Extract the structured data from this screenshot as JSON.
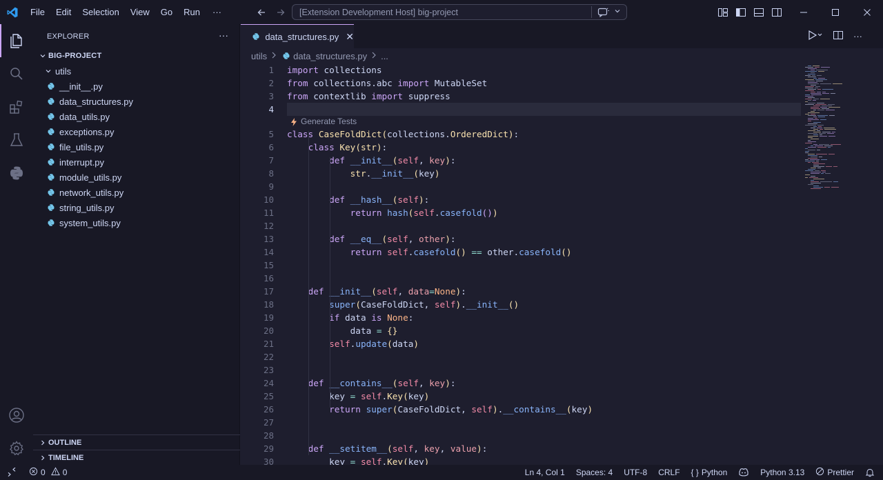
{
  "menu": [
    "File",
    "Edit",
    "Selection",
    "View",
    "Go",
    "Run"
  ],
  "menu_more": "···",
  "command_center": "[Extension Development Host] big-project",
  "explorer": {
    "title": "EXPLORER",
    "more": "···",
    "project": "BIG-PROJECT",
    "folder": "utils",
    "files": [
      "__init__.py",
      "data_structures.py",
      "data_utils.py",
      "exceptions.py",
      "file_utils.py",
      "interrupt.py",
      "module_utils.py",
      "network_utils.py",
      "string_utils.py",
      "system_utils.py"
    ],
    "outline": "OUTLINE",
    "timeline": "TIMELINE"
  },
  "tab": {
    "label": "data_structures.py",
    "close": "✕"
  },
  "breadcrumbs": {
    "folder": "utils",
    "file": "data_structures.py",
    "more": "..."
  },
  "codelens": "Generate Tests",
  "line_numbers": [
    "1",
    "2",
    "3",
    "4",
    "5",
    "6",
    "7",
    "8",
    "9",
    "10",
    "11",
    "12",
    "13",
    "14",
    "15",
    "16",
    "17",
    "18",
    "19",
    "20",
    "21",
    "22",
    "23",
    "24",
    "25",
    "26",
    "27",
    "28",
    "29",
    "30"
  ],
  "current_line": "4",
  "status": {
    "errors": "0",
    "warnings": "0",
    "position": "Ln 4, Col 1",
    "spaces": "Spaces: 4",
    "encoding": "UTF-8",
    "eol": "CRLF",
    "language_icon": "{ }",
    "language": "Python",
    "interpreter": "Python 3.13",
    "formatter": "Prettier"
  },
  "colors": {
    "accent": "#cba6f7",
    "background": "#1e1e2e",
    "sidebar": "#181825",
    "python_icon": "#74c7ec"
  }
}
